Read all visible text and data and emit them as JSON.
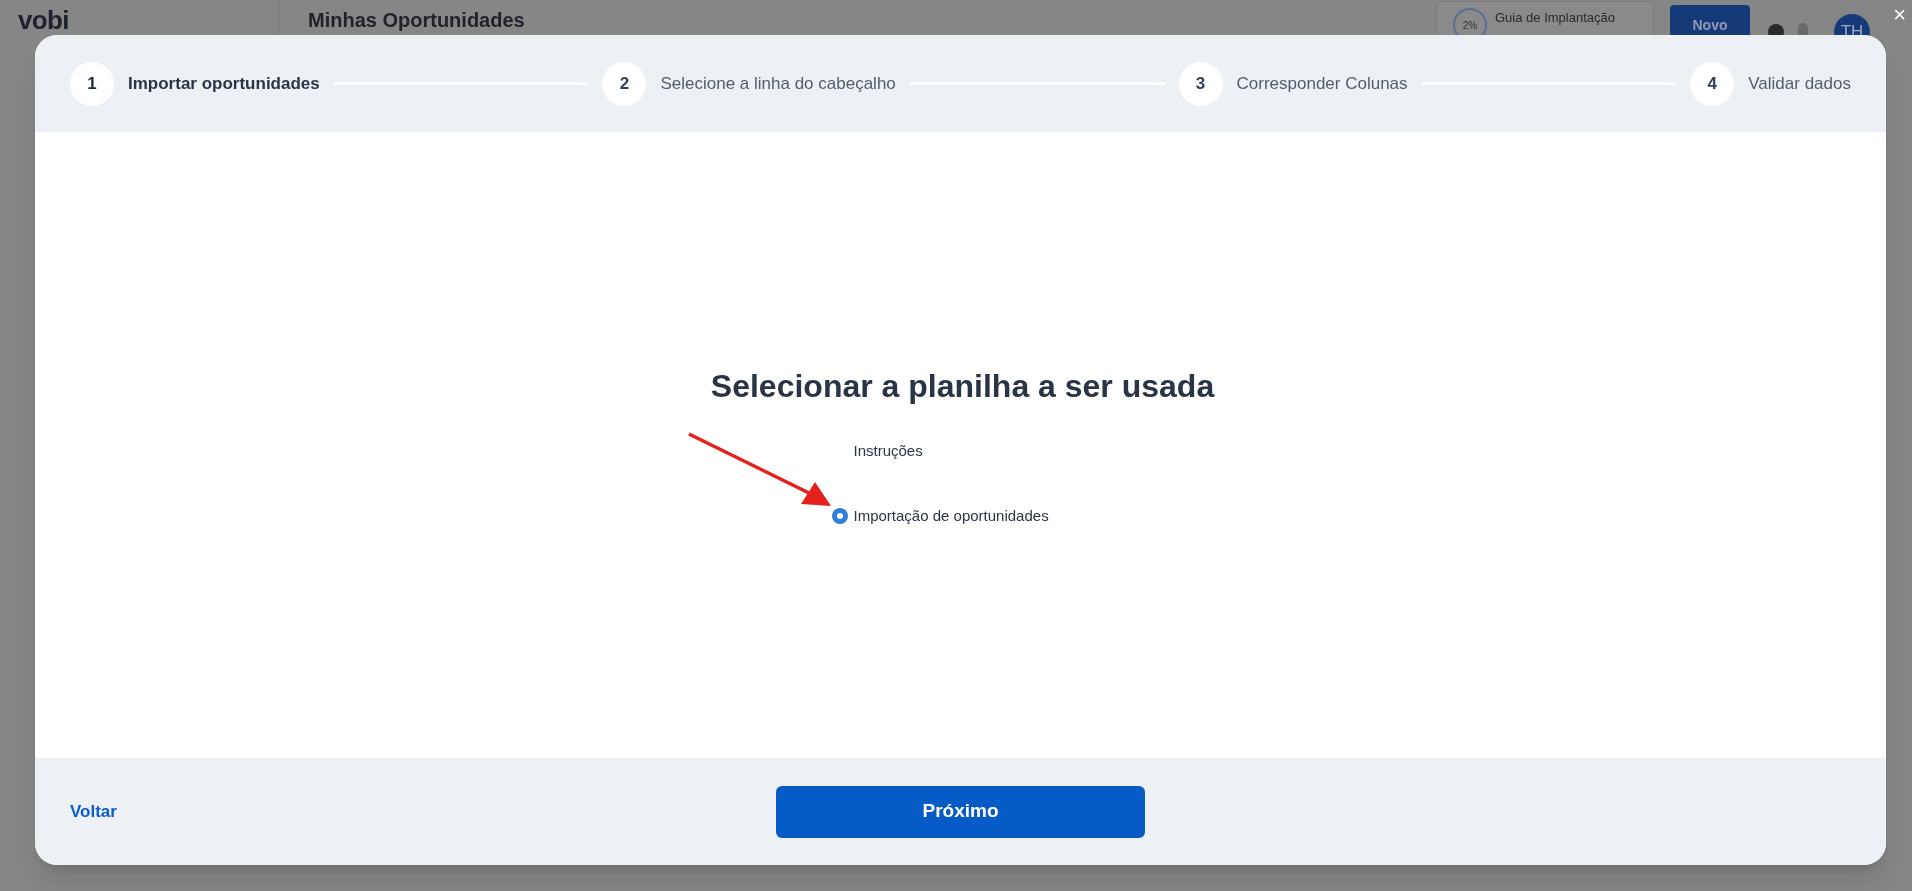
{
  "background": {
    "logo": "vobi",
    "page_title": "Minhas Oportunidades",
    "guide": {
      "percent": "2%",
      "label": "Guia de Implantação"
    },
    "new_button": "Novo",
    "avatar": "TH"
  },
  "close_button": "×",
  "steps": [
    {
      "number": "1",
      "label": "Importar oportunidades",
      "selected": true
    },
    {
      "number": "2",
      "label": "Selecione a linha do cabeçalho",
      "selected": false
    },
    {
      "number": "3",
      "label": "Corresponder Colunas",
      "selected": false
    },
    {
      "number": "4",
      "label": "Validar dados",
      "selected": false
    }
  ],
  "heading": "Selecionar a planilha a ser usada",
  "sheets": [
    {
      "label": "Instruções",
      "selected": false
    },
    {
      "label": "Importação de oportunidades",
      "selected": true
    }
  ],
  "footer": {
    "back": "Voltar",
    "next": "Próximo"
  }
}
